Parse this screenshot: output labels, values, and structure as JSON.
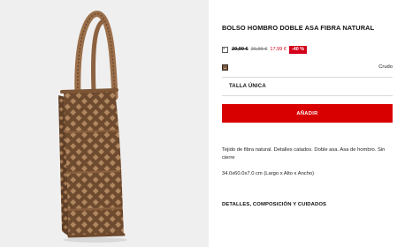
{
  "product": {
    "title": "BOLSO HOMBRO DOBLE ASA FIBRA NATURAL",
    "price": {
      "tag_icon": "price-tag-icon",
      "original": "29,99 €",
      "previous": "20,99 €",
      "current": "17,99 €",
      "discount": "-40 %"
    },
    "color": {
      "swatch_icon": "color-swatch-icon",
      "name": "Crudo"
    },
    "size": {
      "label": "TALLA ÚNICA"
    },
    "add_button_label": "AÑADIR",
    "description": "Tejido de fibra natural. Detalles calados. Doble asa. Asa de hombro. Sin cierre",
    "dimensions": "34.0x60.0x7.0 cm (Largo x Alto x Ancho)",
    "details_link": "DETALLES, COMPOSICIÓN Y CUIDADOS"
  },
  "colors": {
    "sale": "#d4001a",
    "button": "#d80000",
    "image_background": "#efefef"
  }
}
